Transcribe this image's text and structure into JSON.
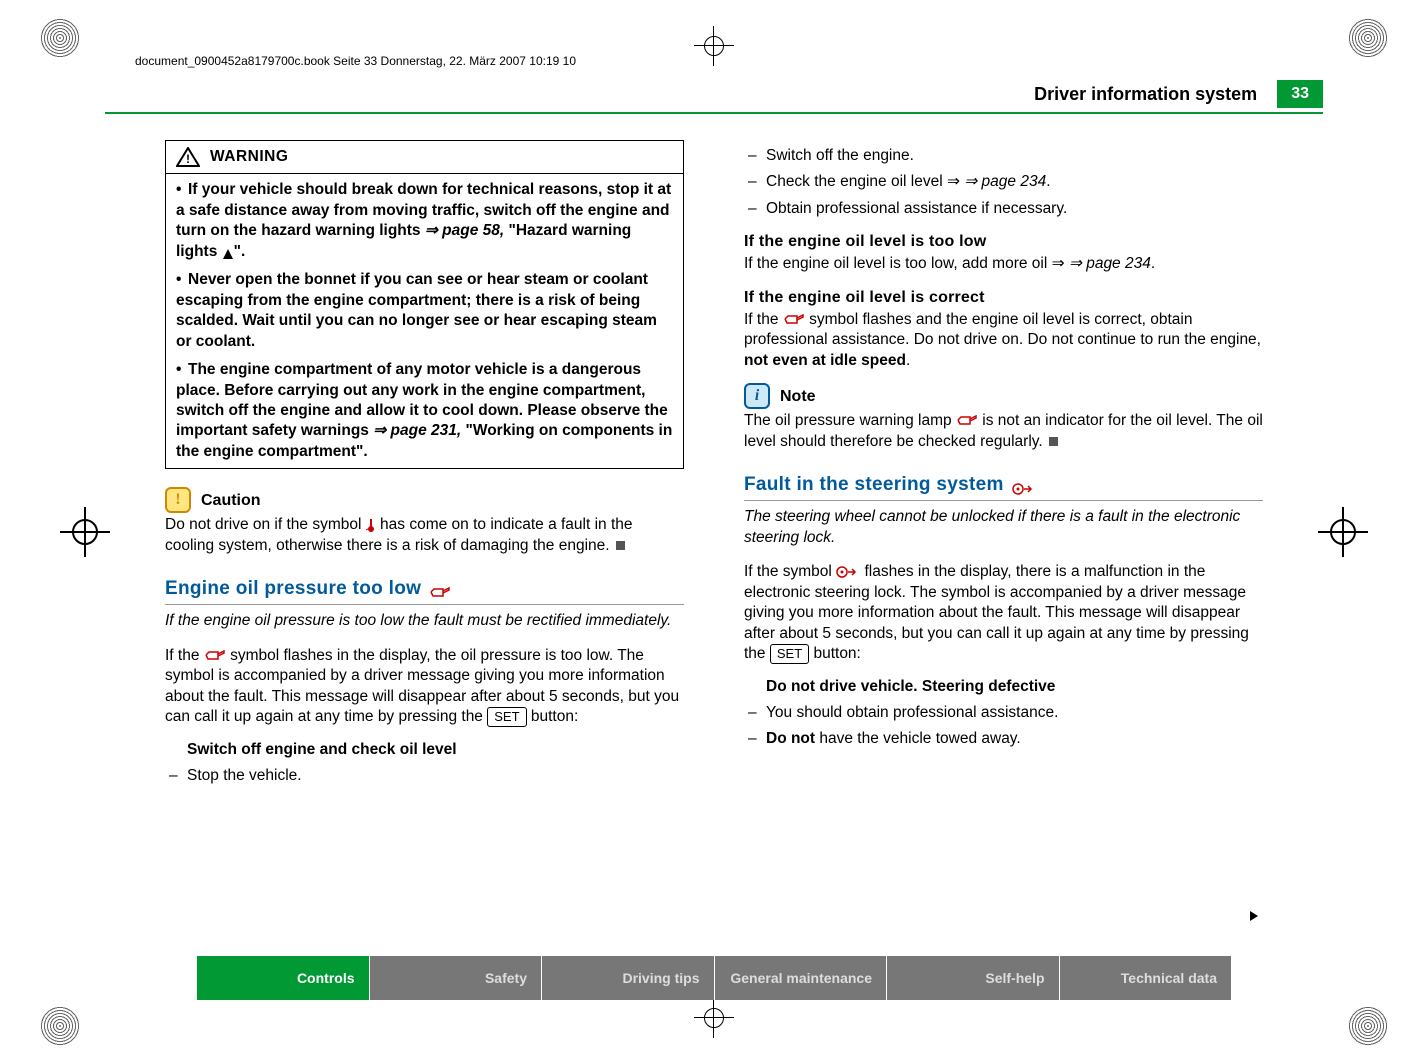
{
  "doc_header": "document_0900452a8179700c.book  Seite 33  Donnerstag, 22. März 2007  10:19 10",
  "header": {
    "section": "Driver information system",
    "page": "33"
  },
  "left": {
    "warning_title": "WARNING",
    "warn1_a": "If your vehicle should break down for technical reasons, stop it at a safe distance away from moving traffic, switch off the engine and turn on the hazard warning lights ",
    "warn1_ref": "⇒ page 58,",
    "warn1_b": " \"Hazard warning lights ",
    "warn1_c": "\".",
    "warn2": "Never open the bonnet if you can see or hear steam or coolant escaping from the engine compartment; there is a risk of being scalded. Wait until you can no longer see or hear escaping steam or coolant.",
    "warn3_a": "The engine compartment of any motor vehicle is a dangerous place. Before carrying out any work in the engine compartment, switch off the engine and allow it to cool down. Please observe the important safety warnings ",
    "warn3_ref": "⇒ page 231,",
    "warn3_b": " \"Working on components in the engine compartment\".",
    "caution_title": "Caution",
    "caution_a": "Do not drive on if the symbol ",
    "caution_b": " has come on to indicate a fault in the cooling system, otherwise there is a risk of damaging the engine.",
    "sec1_title": "Engine oil pressure too low ",
    "sec1_sub": "If the engine oil pressure is too low the fault must be rectified immediately.",
    "sec1_p1_a": "If the ",
    "sec1_p1_b": " symbol flashes in the display, the oil pressure is too low. The symbol is accompanied by a driver message giving you more information about the fault. This message will disappear after about 5 seconds, but you can call it up again at any time by pressing the ",
    "sec1_p1_c": " button:",
    "btn_set": "SET",
    "sec1_msg": "Switch off engine and check oil level",
    "sec1_step1": "Stop the vehicle."
  },
  "right": {
    "step2": "Switch off the engine.",
    "step3_a": "Check the engine oil level ",
    "step3_ref": "⇒ page 234",
    "step3_b": ".",
    "step4": "Obtain professional assistance if necessary.",
    "h1": "If the engine oil level is too low",
    "h1_p_a": "If the engine oil level is too low, add more oil ",
    "h1_ref": "⇒ page 234",
    "h1_p_b": ".",
    "h2": "If the engine oil level is correct",
    "h2_p_a": "If the ",
    "h2_p_b": " symbol flashes and the engine oil level is correct, obtain professional assistance. Do not drive on. Do not continue to run the engine, ",
    "h2_bold": "not even at idle speed",
    "h2_p_c": ".",
    "note_title": "Note",
    "note_a": "The oil pressure warning lamp ",
    "note_b": " is not an indicator for the oil level. The oil level should therefore be checked regularly.",
    "sec2_title": "Fault in the steering system ",
    "sec2_sub": "The steering wheel cannot be unlocked if there is a fault in the electronic steering lock.",
    "sec2_p1_a": "If the symbol ",
    "sec2_p1_b": " flashes in the display, there is a malfunction in the electronic steering lock. The symbol is accompanied by a driver message giving you more information about the fault. This message will disappear after about 5 seconds, but you can call it up again at any time by pressing the ",
    "sec2_p1_c": " button:",
    "sec2_msg": "Do not drive vehicle. Steering defective",
    "sec2_step1": "You should obtain professional assistance.",
    "sec2_step2_a": "Do not",
    "sec2_step2_b": " have the vehicle towed away."
  },
  "footer": {
    "nav": [
      "Controls",
      "Safety",
      "Driving tips",
      "General maintenance",
      "Self-help",
      "Technical data"
    ]
  }
}
